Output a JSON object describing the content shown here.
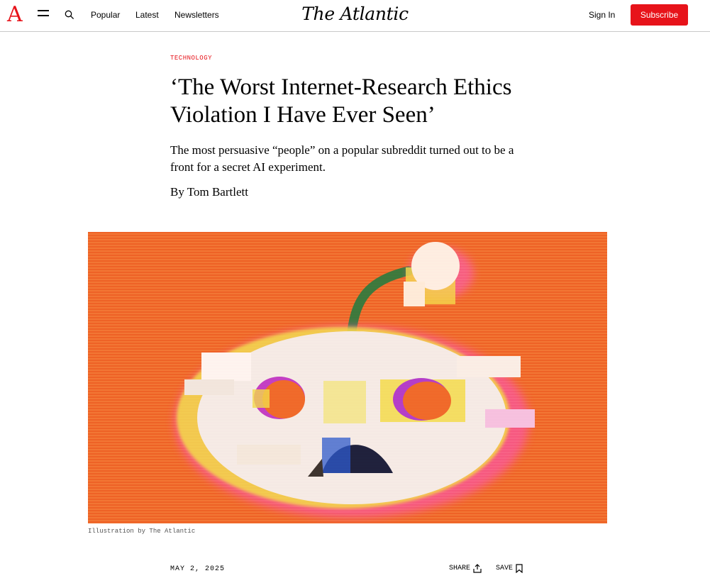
{
  "header": {
    "logo_letter": "A",
    "nav": [
      "Popular",
      "Latest",
      "Newsletters"
    ],
    "masthead": "The Atlantic",
    "signin_label": "Sign In",
    "subscribe_label": "Subscribe",
    "accent_color": "#e7131a",
    "icons": [
      "menu-icon",
      "search-icon"
    ]
  },
  "article": {
    "section": "TECHNOLOGY",
    "headline": "‘The Worst Internet-Research Ethics Violation I Have Ever Seen’",
    "dek": "The most persuasive “people” on a popular subreddit turned out to be a front for a secret AI experiment.",
    "byline_prefix": "By",
    "author": "Tom Bartlett",
    "image_caption": "Illustration by The Atlantic",
    "date": "MAY 2, 2025",
    "share_label": "SHARE",
    "save_label": "SAVE",
    "hero_background": "#f06a2a",
    "icons": [
      "share-icon",
      "bookmark-icon"
    ]
  }
}
